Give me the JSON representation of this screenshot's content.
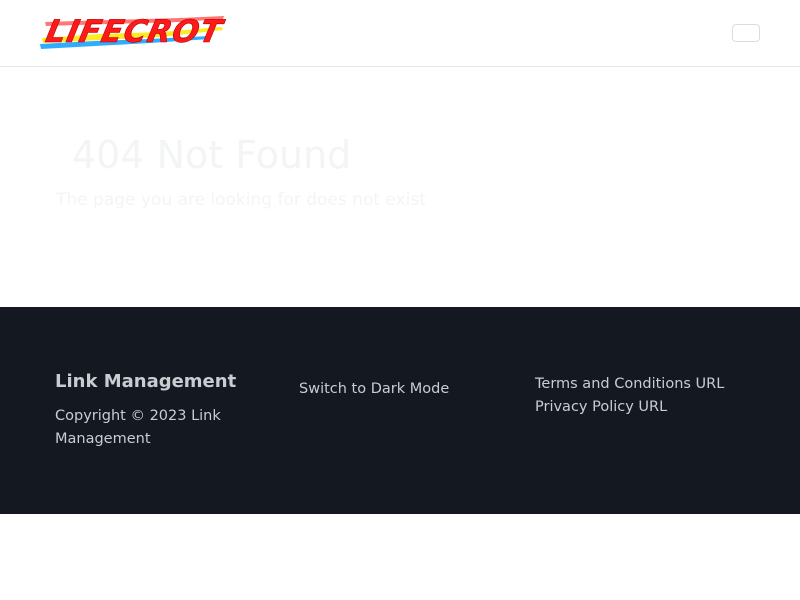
{
  "header": {
    "logo_text": "LIFECROT",
    "menu_toggle_icon": "hamburger-icon"
  },
  "main": {
    "title": "404 Not Found",
    "subtitle": "The page you are looking for does not exist"
  },
  "footer": {
    "brand": "Link Management",
    "copyright": "Copyright © 2023 Link Management",
    "dark_mode_label": "Switch to Dark Mode",
    "links": [
      {
        "label": "Terms and Conditions URL"
      },
      {
        "label": "Privacy Policy URL"
      }
    ]
  },
  "colors": {
    "footer_bg": "#141821",
    "footer_text": "#c9ccd1",
    "logo_red": "#ff1a1a",
    "logo_yellow": "#ffe600",
    "logo_blue": "#1aa3ff"
  }
}
